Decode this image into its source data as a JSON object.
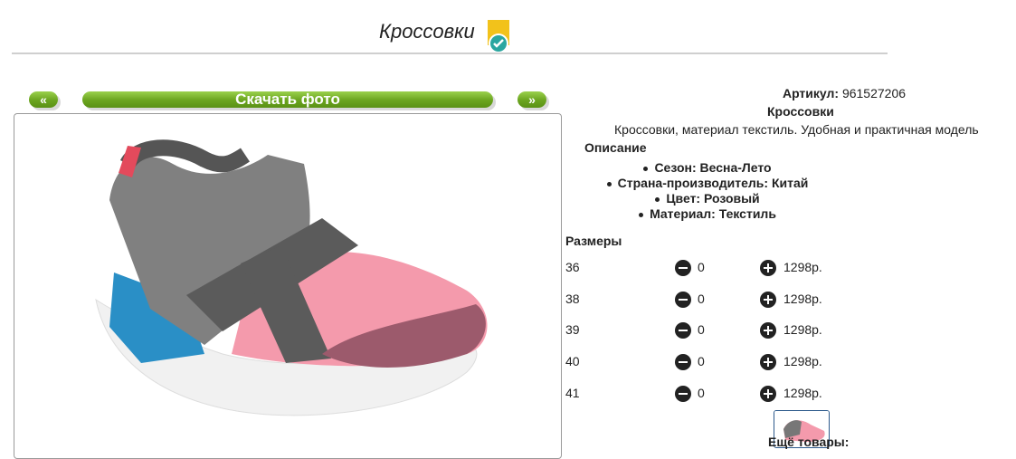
{
  "page": {
    "title": "Кроссовки",
    "accent_green": "#6aa41f",
    "badge_color": "#f2c21b"
  },
  "nav": {
    "prev_label": "«",
    "download_label": "Скачать фото",
    "next_label": "»"
  },
  "product": {
    "article_label": "Артикул:",
    "article_value": "961527206",
    "name": "Кроссовки",
    "description": "Кроссовки, материал текстиль. Удобная и практичная модель",
    "desc_heading": "Описание",
    "features": [
      "Сезон: Весна-Лето",
      "Страна-производитель: Китай",
      "Цвет: Розовый",
      "Материал: Текстиль"
    ]
  },
  "sizes": {
    "heading": "Размеры",
    "rows": [
      {
        "size": "36",
        "qty": "0",
        "price": "1298р."
      },
      {
        "size": "38",
        "qty": "0",
        "price": "1298р."
      },
      {
        "size": "39",
        "qty": "0",
        "price": "1298р."
      },
      {
        "size": "40",
        "qty": "0",
        "price": "1298р."
      },
      {
        "size": "41",
        "qty": "0",
        "price": "1298р."
      }
    ]
  },
  "more": {
    "label": "Ещё товары:"
  }
}
